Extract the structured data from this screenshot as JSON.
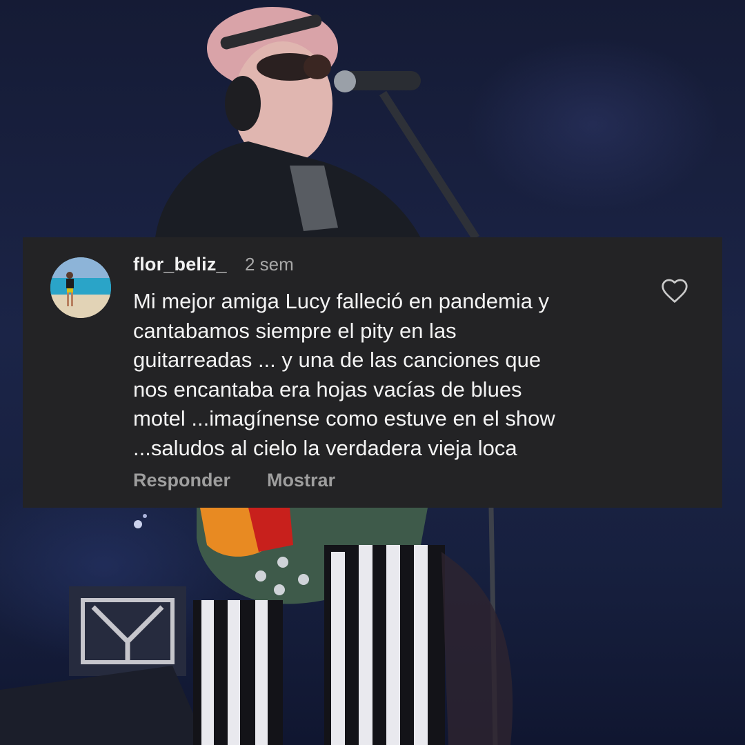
{
  "comment": {
    "username": "flor_beliz_",
    "timestamp": "2 sem",
    "text": "Mi mejor amiga Lucy falleció en pandemia y\ncantabamos siempre el pity en las\nguitarreadas ... y una de las canciones que\nnos encantaba era hojas vacías de blues\nmotel ...imagínense como estuve en el show\n...saludos al cielo la verdadera vieja loca",
    "actions": {
      "reply_label": "Responder",
      "show_label": "Mostrar"
    },
    "icons": {
      "like": "heart-outline-icon",
      "avatar": "user-avatar"
    }
  },
  "colors": {
    "card_background": "#232325",
    "username": "#f1f1f1",
    "secondary_text": "#a8a8a8",
    "action_text": "#9e9e9e"
  }
}
